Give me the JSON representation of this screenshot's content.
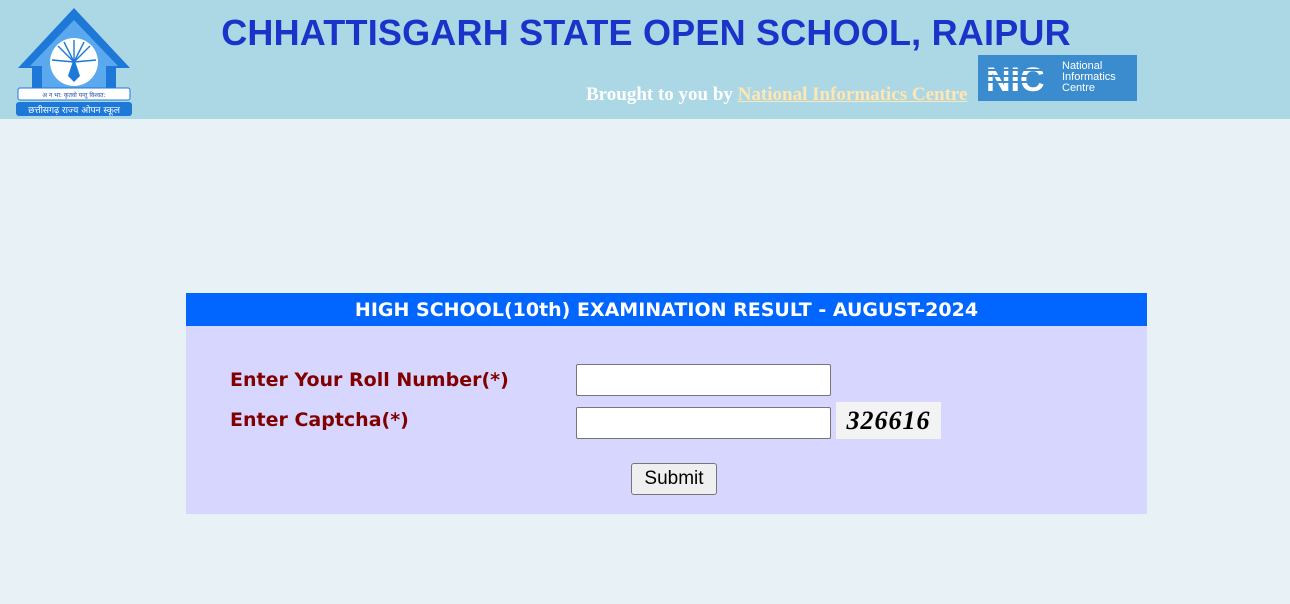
{
  "header": {
    "title": "CHHATTISGARH STATE OPEN SCHOOL, RAIPUR",
    "brought_prefix": "Brought to you by ",
    "nic_link": "National Informatics Centre",
    "logo_caption_top": "अ न भा: कृतवो यन्तु विश्वत:",
    "logo_caption_bottom": "छत्तीसगढ़ राज्य ओपन स्कूल",
    "nic_logo": {
      "mark": "NIC",
      "line1": "National",
      "line2": "Informatics",
      "line3": "Centre"
    }
  },
  "form": {
    "heading": "HIGH SCHOOL(10th) EXAMINATION RESULT - AUGUST-2024",
    "roll_label": "Enter Your Roll Number(*)",
    "roll_value": "",
    "captcha_label": "Enter Captcha(*)",
    "captcha_value": "",
    "captcha_code": "326616",
    "submit_label": "Submit"
  },
  "colors": {
    "header_bg": "#acd8e6",
    "page_bg": "#e8f1f5",
    "title": "#1a33c8",
    "panel_head": "#0066ff",
    "panel_bg": "#d6d6ff",
    "label": "#800000"
  }
}
